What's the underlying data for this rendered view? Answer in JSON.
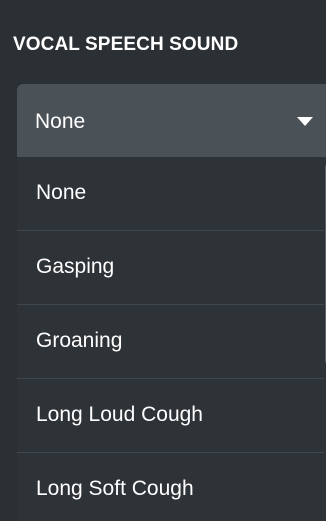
{
  "section": {
    "label": "VOCAL SPEECH SOUND"
  },
  "select": {
    "value": "None",
    "icon": "caret-down-icon"
  },
  "menu": {
    "items": [
      {
        "label": "None"
      },
      {
        "label": "Gasping"
      },
      {
        "label": "Groaning"
      },
      {
        "label": "Long Loud Cough"
      },
      {
        "label": "Long Soft Cough"
      }
    ]
  },
  "colors": {
    "background": "#2b3034",
    "select_bg": "#4a5157",
    "menu_bg": "#2e3337",
    "divider": "#3f464c",
    "text": "#ffffff"
  }
}
